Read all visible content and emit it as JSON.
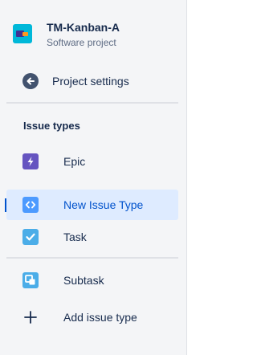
{
  "project": {
    "name": "TM-Kanban-A",
    "type": "Software project"
  },
  "nav": {
    "project_settings_label": "Project settings"
  },
  "issue_types": {
    "title": "Issue types",
    "items": [
      {
        "label": "Epic",
        "icon": "epic-icon",
        "color": "#6554c0",
        "selected": false
      },
      {
        "label": "New Issue Type",
        "icon": "code-icon",
        "color": "#4c9aff",
        "selected": true
      },
      {
        "label": "Task",
        "icon": "task-icon",
        "color": "#4bade8",
        "selected": false
      },
      {
        "label": "Subtask",
        "icon": "subtask-icon",
        "color": "#4bade8",
        "selected": false
      }
    ],
    "add_label": "Add issue type"
  },
  "colors": {
    "sidebar_bg": "#f4f5f7",
    "selected_bg": "#deebff",
    "accent": "#0052cc"
  }
}
